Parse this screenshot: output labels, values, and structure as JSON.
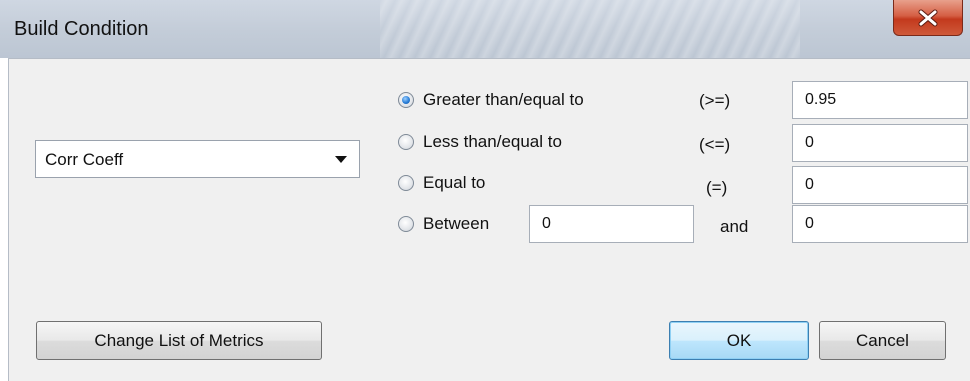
{
  "window": {
    "title": "Build Condition",
    "close_icon": "close-x"
  },
  "metric_select": {
    "value": "Corr Coeff"
  },
  "conditions": [
    {
      "label": "Greater than/equal to",
      "operator": "(>=)",
      "value": "0.95",
      "checked": true
    },
    {
      "label": "Less than/equal to",
      "operator": "(<=)",
      "value": "0",
      "checked": false
    },
    {
      "label": "Equal to",
      "operator": "(=)",
      "value": "0",
      "checked": false
    },
    {
      "label": "Between",
      "operator": "and",
      "low_value": "0",
      "value": "0",
      "checked": false
    }
  ],
  "buttons": {
    "change_metrics": "Change List of Metrics",
    "ok": "OK",
    "cancel": "Cancel"
  }
}
